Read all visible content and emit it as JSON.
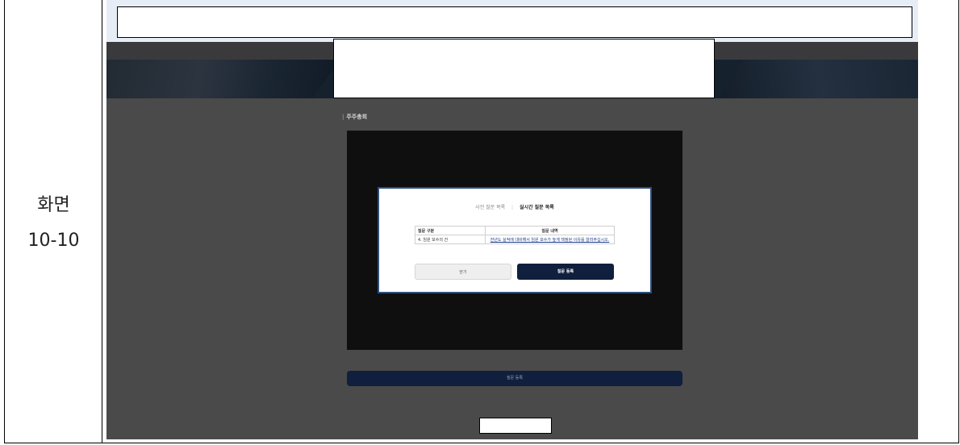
{
  "label": {
    "line1": "화면",
    "line2": "10-10"
  },
  "section": {
    "bar": "|",
    "title": "주주총회"
  },
  "modal": {
    "tab_pre": "사전 질문 목록",
    "tab_sep": "|",
    "tab_live": "실시간 질문 목록",
    "table": {
      "headers": [
        "질문 구분",
        "질문 내역"
      ],
      "rows": [
        [
          "4. 임원 보수의 건",
          "전년도 실적에 대비해서 임원 보수가 높게 책정된 이유를 알려주십시오."
        ]
      ]
    },
    "close_label": "닫기",
    "submit_label": "질문 등록"
  },
  "bottom_button_label": "질문 등록",
  "colors": {
    "navy": "#0f1f3d",
    "modal_border": "#2c4e7d",
    "page_dim": "#4a4a4a"
  }
}
